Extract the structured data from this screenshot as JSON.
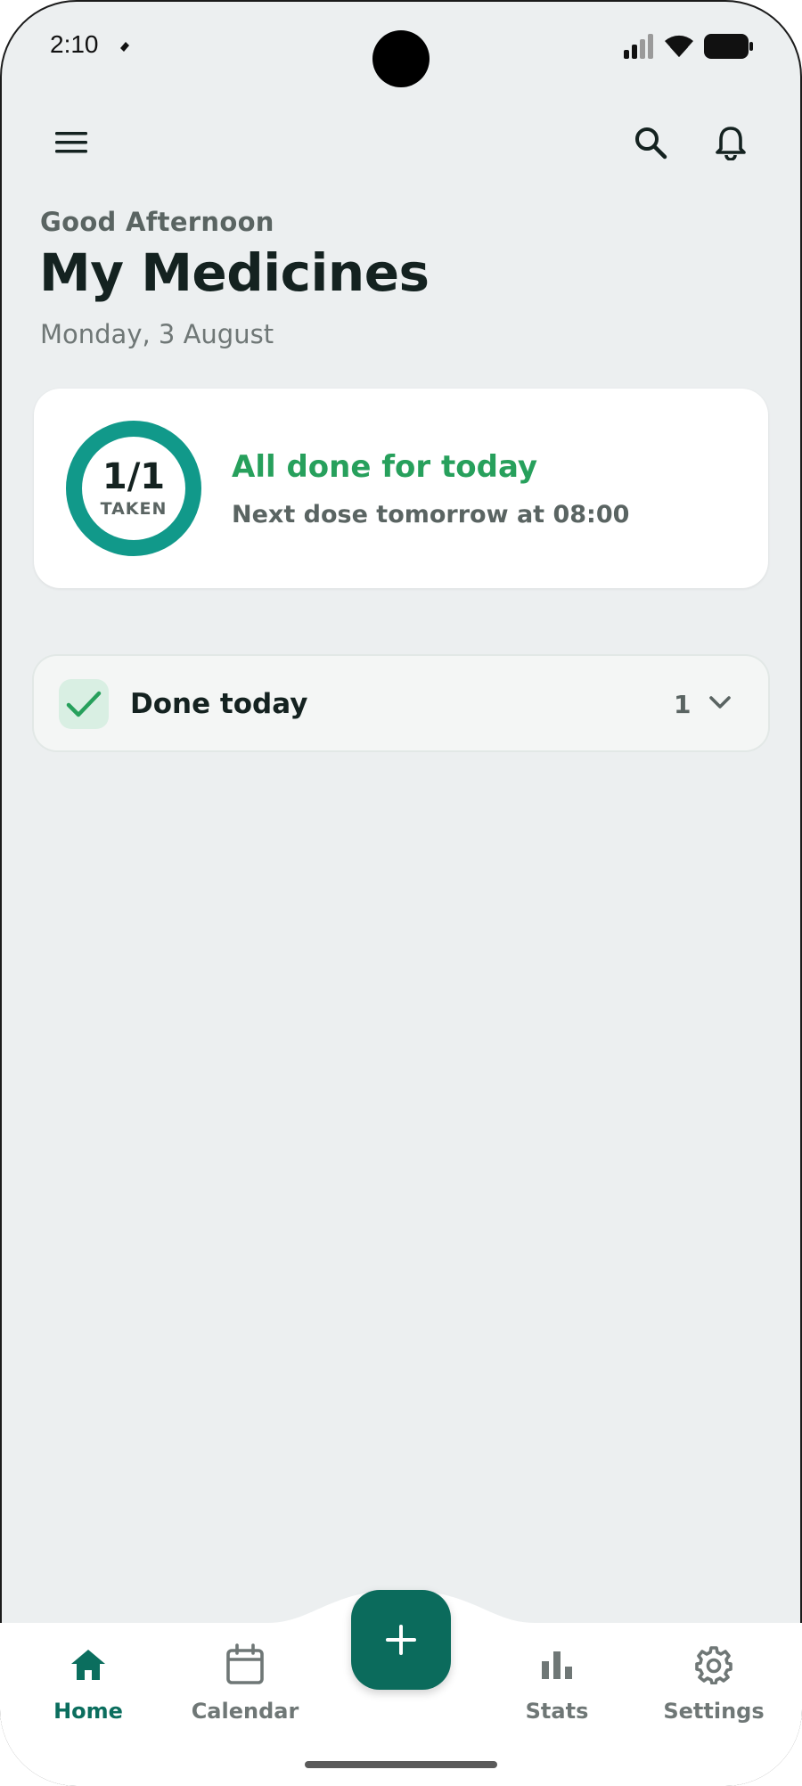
{
  "status_bar": {
    "time": "2:10"
  },
  "header": {
    "greeting": "Good Afternoon",
    "title": "My Medicines",
    "date": "Monday, 3 August"
  },
  "summary": {
    "count": "1/1",
    "label": "TAKEN",
    "progress": 1.0,
    "status_title": "All done for today",
    "status_subtitle": "Next dose tomorrow at 08:00"
  },
  "done_today": {
    "label": "Done today",
    "count": "1"
  },
  "nav": {
    "items": [
      {
        "label": "Home",
        "icon": "home-icon",
        "active": true
      },
      {
        "label": "Calendar",
        "icon": "calendar-icon"
      },
      {
        "label": "Stats",
        "icon": "bar-chart-icon"
      },
      {
        "label": "Settings",
        "icon": "gear-icon"
      }
    ],
    "fab_icon": "plus-icon"
  },
  "colors": {
    "background": "#eceff0",
    "accent": "#0b6b5c",
    "success": "#27a05c",
    "ring": "#11998a"
  }
}
